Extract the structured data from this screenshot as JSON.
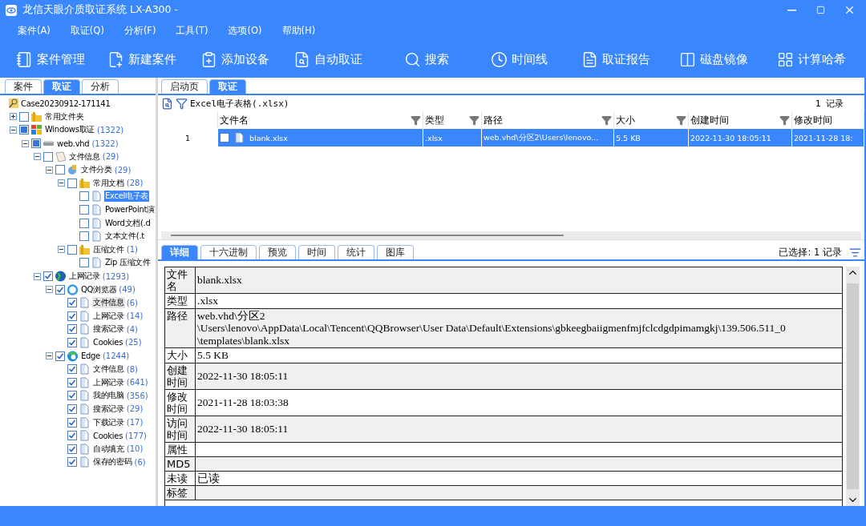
{
  "window": {
    "title": "龙信天眼介质取证系统 LX-A300 -"
  },
  "menu": [
    "案件(A)",
    "取证(Q)",
    "分析(F)",
    "工具(T)",
    "选项(O)",
    "帮助(H)"
  ],
  "toolbar": [
    {
      "kind": "book",
      "label": "案件管理"
    },
    {
      "kind": "new",
      "label": "新建案件"
    },
    {
      "kind": "device",
      "label": "添加设备"
    },
    {
      "kind": "auto",
      "label": "自动取证"
    },
    {
      "kind": "search",
      "label": "搜索"
    },
    {
      "kind": "clock",
      "label": "时间线"
    },
    {
      "kind": "report",
      "label": "取证报告"
    },
    {
      "kind": "disk",
      "label": "磁盘镜像"
    },
    {
      "kind": "hash",
      "label": "计算哈希"
    }
  ],
  "left_tabs": [
    {
      "label": "案件",
      "selected": false
    },
    {
      "label": "取证",
      "selected": true
    },
    {
      "label": "分析",
      "selected": false
    }
  ],
  "case_root": "Case20230912-171141",
  "tree": [
    {
      "kind": "folder",
      "label": "常用文件夹",
      "checked": false,
      "partial": false,
      "expanded": false,
      "selected": false,
      "hovered": false
    },
    {
      "kind": "windows",
      "label": "Windows取证",
      "count": "(1322)",
      "checked": false,
      "partial": true,
      "expanded": true,
      "selected": false,
      "hovered": false,
      "children": [
        {
          "kind": "disk",
          "label": "web.vhd",
          "count": "(1322)",
          "checked": false,
          "partial": true,
          "expanded": true,
          "selected": false,
          "hovered": false,
          "children": [
            {
              "kind": "info",
              "label": "文件信息",
              "count": "(29)",
              "checked": false,
              "partial": false,
              "expanded": true,
              "selected": false,
              "hovered": false,
              "children": [
                {
                  "kind": "category",
                  "label": "文件分类",
                  "count": "(29)",
                  "checked": false,
                  "partial": false,
                  "expanded": true,
                  "selected": false,
                  "hovered": false,
                  "children": [
                    {
                      "kind": "folder",
                      "label": "常用文档",
                      "count": "(28)",
                      "checked": false,
                      "partial": false,
                      "expanded": true,
                      "selected": false,
                      "hovered": false,
                      "children": [
                        {
                          "kind": "file",
                          "label": "Excel电子表",
                          "checked": false,
                          "partial": false,
                          "selected": true,
                          "hovered": false
                        },
                        {
                          "kind": "file",
                          "label": "PowerPoint演",
                          "checked": false,
                          "partial": false,
                          "selected": false,
                          "hovered": false
                        },
                        {
                          "kind": "file",
                          "label": "Word文档(.d",
                          "checked": false,
                          "partial": false,
                          "selected": false,
                          "hovered": false
                        },
                        {
                          "kind": "file",
                          "label": "文本文件(.t",
                          "checked": false,
                          "partial": false,
                          "selected": false,
                          "hovered": false
                        }
                      ]
                    },
                    {
                      "kind": "folder",
                      "label": "压缩文件",
                      "count": "(1)",
                      "checked": false,
                      "partial": false,
                      "expanded": true,
                      "selected": false,
                      "hovered": false,
                      "children": [
                        {
                          "kind": "file",
                          "label": "Zip 压缩文件",
                          "checked": false,
                          "partial": false,
                          "selected": false,
                          "hovered": false
                        }
                      ]
                    }
                  ]
                }
              ]
            },
            {
              "kind": "globe",
              "label": "上网记录",
              "count": "(1293)",
              "checked": true,
              "partial": false,
              "expanded": true,
              "selected": false,
              "hovered": false,
              "children": [
                {
                  "kind": "qq",
                  "label": "QQ浏览器",
                  "count": "(49)",
                  "checked": true,
                  "partial": false,
                  "expanded": true,
                  "selected": false,
                  "hovered": false,
                  "children": [
                    {
                      "kind": "file",
                      "label": "文件信息",
                      "count": "(6)",
                      "checked": true,
                      "partial": false,
                      "selected": false,
                      "hovered": true
                    },
                    {
                      "kind": "file",
                      "label": "上网记录",
                      "count": "(14)",
                      "checked": true,
                      "partial": false,
                      "selected": false,
                      "hovered": false
                    },
                    {
                      "kind": "file",
                      "label": "搜索记录",
                      "count": "(4)",
                      "checked": true,
                      "partial": false,
                      "selected": false,
                      "hovered": false
                    },
                    {
                      "kind": "file",
                      "label": "Cookies",
                      "count": "(25)",
                      "checked": true,
                      "partial": false,
                      "selected": false,
                      "hovered": false
                    }
                  ]
                },
                {
                  "kind": "edge",
                  "label": "Edge",
                  "count": "(1244)",
                  "checked": true,
                  "partial": false,
                  "expanded": true,
                  "selected": false,
                  "hovered": false,
                  "children": [
                    {
                      "kind": "file",
                      "label": "文件信息",
                      "count": "(8)",
                      "checked": true,
                      "partial": false,
                      "selected": false,
                      "hovered": false
                    },
                    {
                      "kind": "file",
                      "label": "上网记录",
                      "count": "(641)",
                      "checked": true,
                      "partial": false,
                      "selected": false,
                      "hovered": false
                    },
                    {
                      "kind": "file",
                      "label": "我的电脑",
                      "count": "(356)",
                      "checked": true,
                      "partial": false,
                      "selected": false,
                      "hovered": false
                    },
                    {
                      "kind": "file",
                      "label": "搜索记录",
                      "count": "(29)",
                      "checked": true,
                      "partial": false,
                      "selected": false,
                      "hovered": false
                    },
                    {
                      "kind": "file",
                      "label": "下载记录",
                      "count": "(17)",
                      "checked": true,
                      "partial": false,
                      "selected": false,
                      "hovered": false
                    },
                    {
                      "kind": "file",
                      "label": "Cookies",
                      "count": "(177)",
                      "checked": true,
                      "partial": false,
                      "selected": false,
                      "hovered": false
                    },
                    {
                      "kind": "file",
                      "label": "自动填充",
                      "count": "(10)",
                      "checked": true,
                      "partial": false,
                      "selected": false,
                      "hovered": false
                    },
                    {
                      "kind": "file",
                      "label": "保存的密码",
                      "count": "(6)",
                      "checked": true,
                      "partial": false,
                      "selected": false,
                      "hovered": false
                    }
                  ]
                }
              ]
            }
          ]
        }
      ]
    }
  ],
  "right_tabs": [
    {
      "label": "启动页",
      "selected": false
    },
    {
      "label": "取证",
      "selected": true
    }
  ],
  "list": {
    "title": "Excel电子表格(.xlsx)",
    "record_count": "1 记录",
    "columns": [
      "文件名",
      "类型",
      "路径",
      "大小",
      "创建时间",
      "修改时间"
    ],
    "rows": [
      {
        "index": "1",
        "selected": true,
        "checked": false,
        "cells": [
          "blank.xlsx",
          ".xlsx",
          "web.vhd\\分区2\\Users\\lenovo...",
          "5.5 KB",
          "2022-11-30 18:05:11",
          "2021-11-28 18:"
        ]
      }
    ]
  },
  "detail_tabs": [
    {
      "label": "详细",
      "selected": true
    },
    {
      "label": "十六进制",
      "selected": false
    },
    {
      "label": "预览",
      "selected": false
    },
    {
      "label": "时间",
      "selected": false
    },
    {
      "label": "统计",
      "selected": false
    },
    {
      "label": "图库",
      "selected": false
    }
  ],
  "selected_count": "已选择: 1 记录",
  "details": [
    {
      "label": "文件名",
      "value": "blank.xlsx"
    },
    {
      "label": "类型",
      "value": ".xlsx"
    },
    {
      "label": "路径",
      "value": "web.vhd\\分区2\n\\Users\\lenovo\\AppData\\Local\\Tencent\\QQBrowser\\User Data\\Default\\Extensions\\gbkeegbaiigmenfmjfclcdgdpimamgkj\\139.506.511_0\n\\templates\\blank.xlsx"
    },
    {
      "label": "大小",
      "value": "5.5 KB"
    },
    {
      "label": "创建时间",
      "value": "2022-11-30 18:05:11"
    },
    {
      "label": "修改时间",
      "value": "2021-11-28 18:03:38"
    },
    {
      "label": "访问时间",
      "value": "2022-11-30 18:05:11"
    },
    {
      "label": "属性"
    },
    {
      "label": "MD5"
    },
    {
      "label": "未读",
      "value": "已读"
    },
    {
      "label": "标签"
    }
  ]
}
